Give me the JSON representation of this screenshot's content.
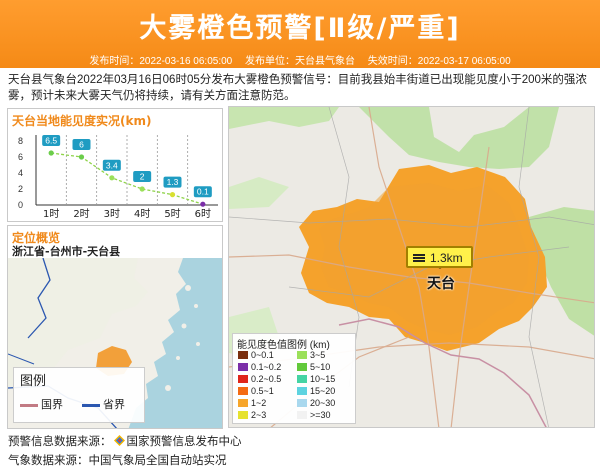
{
  "header": {
    "title": "大雾橙色预警[Ⅱ级/严重]",
    "publish_time": "发布时间：2022-03-16 06:05:00",
    "publisher": "发布单位：天台县气象台",
    "expire_time": "失效时间：2022-03-17 06:05:00",
    "bg_color": "#f58a16"
  },
  "intro": "天台县气象台2022年03月16日06时05分发布大雾橙色预警信号：目前我县始丰街道已出现能见度小于200米的强浓雾，预计未来大雾天气仍将持续，请有关方面注意防范。",
  "visibility_panel": {
    "title": "天台当地能见度实况(km)",
    "chart_data": {
      "type": "line",
      "categories": [
        "1时",
        "2时",
        "3时",
        "4时",
        "5时",
        "6时"
      ],
      "values": [
        6.5,
        6,
        3.4,
        2,
        1.3,
        0.1
      ],
      "value_labels": [
        "6.5",
        "6",
        "3.4",
        "2",
        "1.3",
        "0.1"
      ],
      "ylim": [
        0,
        8
      ],
      "yticks": [
        "0",
        "2",
        "4",
        "6",
        "8"
      ],
      "title": "天台当地能见度实况(km)"
    }
  },
  "location_panel": {
    "title": "定位概览",
    "subtitle": "浙江省-台州市-天台县",
    "legend": {
      "title": "图例",
      "items": [
        {
          "label": "国界",
          "color": "#c27b84"
        },
        {
          "label": "省界",
          "color": "#2b57b0"
        }
      ]
    }
  },
  "main_map": {
    "badge_value": "1.3km",
    "city_label": "天台",
    "fog_color": "#f5a22c",
    "color_legend": {
      "title": "能见度色值图例 (km)",
      "left_items": [
        {
          "label": "0~0.1",
          "color": "#7a2e0e"
        },
        {
          "label": "0.1~0.2",
          "color": "#7b2ea8"
        },
        {
          "label": "0.2~0.5",
          "color": "#e0251a"
        },
        {
          "label": "0.5~1",
          "color": "#f46a12"
        },
        {
          "label": "1~2",
          "color": "#f7a52a"
        },
        {
          "label": "2~3",
          "color": "#e6e230"
        }
      ],
      "right_items": [
        {
          "label": "3~5",
          "color": "#9be05a"
        },
        {
          "label": "5~10",
          "color": "#62c93b"
        },
        {
          "label": "10~15",
          "color": "#45d4a4"
        },
        {
          "label": "15~20",
          "color": "#5ed3e0"
        },
        {
          "label": "20~30",
          "color": "#a9d8ee"
        },
        {
          "label": ">=30",
          "color": "#f2f2f2"
        }
      ]
    }
  },
  "footer": {
    "warning_source": "预警信息数据来源：",
    "warning_source_name": "国家预警信息发布中心",
    "weather_source": "气象数据来源：中国气象局全国自动站实况"
  }
}
